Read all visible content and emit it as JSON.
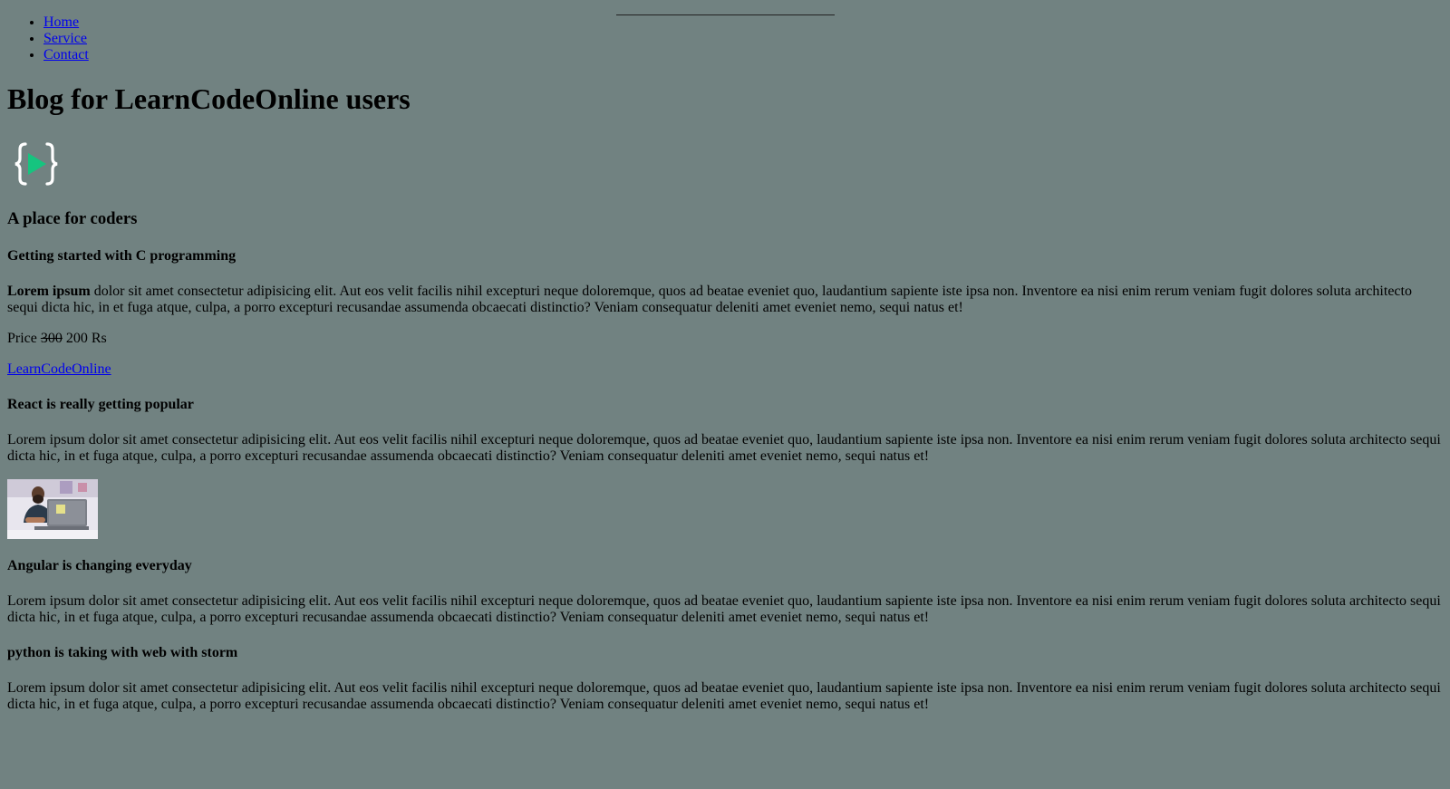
{
  "nav": {
    "items": [
      {
        "label": "Home"
      },
      {
        "label": "Service"
      },
      {
        "label": "Contact"
      }
    ]
  },
  "header": {
    "title": "Blog for LearnCodeOnline users",
    "logo_icon": "code-play-logo-icon",
    "tagline": "A place for coders"
  },
  "posts": [
    {
      "title": "Getting started with C programming",
      "lead_bold": "Lorem ipsum",
      "body": " dolor sit amet consectetur adipisicing elit. Aut eos velit facilis nihil excepturi neque doloremque, quos ad beatae eveniet quo, laudantium sapiente iste ipsa non. Inventore ea nisi enim rerum veniam fugit dolores soluta architecto sequi dicta hic, in et fuga atque, culpa, a porro excepturi recusandae assumenda obcaecati distinctio? Veniam consequatur deleniti amet eveniet nemo, sequi natus et!",
      "price_label": "Price",
      "price_old": "300",
      "price_new": "200 Rs",
      "link_text": "LearnCodeOnline"
    },
    {
      "title": "React is really getting popular",
      "body": "Lorem ipsum dolor sit amet consectetur adipisicing elit. Aut eos velit facilis nihil excepturi neque doloremque, quos ad beatae eveniet quo, laudantium sapiente iste ipsa non. Inventore ea nisi enim rerum veniam fugit dolores soluta architecto sequi dicta hic, in et fuga atque, culpa, a porro excepturi recusandae assumenda obcaecati distinctio? Veniam consequatur deleniti amet eveniet nemo, sequi natus et!",
      "image_icon": "person-with-laptop-photo"
    },
    {
      "title": "Angular is changing everyday",
      "body": "Lorem ipsum dolor sit amet consectetur adipisicing elit. Aut eos velit facilis nihil excepturi neque doloremque, quos ad beatae eveniet quo, laudantium sapiente iste ipsa non. Inventore ea nisi enim rerum veniam fugit dolores soluta architecto sequi dicta hic, in et fuga atque, culpa, a porro excepturi recusandae assumenda obcaecati distinctio? Veniam consequatur deleniti amet eveniet nemo, sequi natus et!"
    },
    {
      "title": "python is taking with web with storm",
      "body": "Lorem ipsum dolor sit amet consectetur adipisicing elit. Aut eos velit facilis nihil excepturi neque doloremque, quos ad beatae eveniet quo, laudantium sapiente iste ipsa non. Inventore ea nisi enim rerum veniam fugit dolores soluta architecto sequi dicta hic, in et fuga atque, culpa, a porro excepturi recusandae assumenda obcaecati distinctio? Veniam consequatur deleniti amet eveniet nemo, sequi natus et!"
    }
  ],
  "colors": {
    "background": "#718281",
    "link": "#0000ee",
    "logo_brace": "#ffffff",
    "logo_play": "#16c47f"
  }
}
